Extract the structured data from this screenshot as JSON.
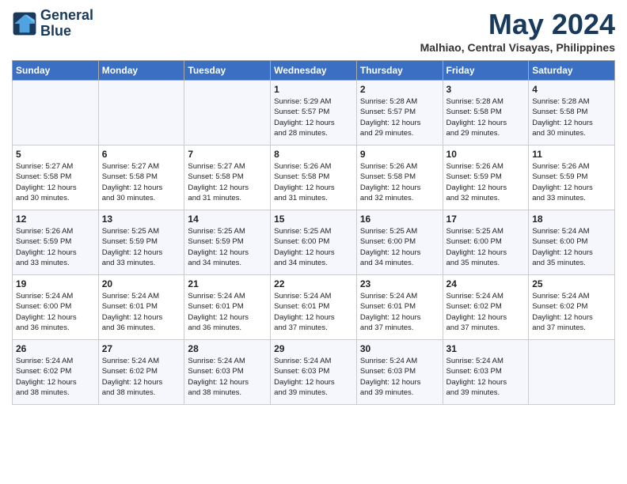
{
  "header": {
    "logo_line1": "General",
    "logo_line2": "Blue",
    "month_title": "May 2024",
    "location": "Malhiao, Central Visayas, Philippines"
  },
  "weekdays": [
    "Sunday",
    "Monday",
    "Tuesday",
    "Wednesday",
    "Thursday",
    "Friday",
    "Saturday"
  ],
  "weeks": [
    [
      {
        "day": "",
        "info": ""
      },
      {
        "day": "",
        "info": ""
      },
      {
        "day": "",
        "info": ""
      },
      {
        "day": "1",
        "info": "Sunrise: 5:29 AM\nSunset: 5:57 PM\nDaylight: 12 hours\nand 28 minutes."
      },
      {
        "day": "2",
        "info": "Sunrise: 5:28 AM\nSunset: 5:57 PM\nDaylight: 12 hours\nand 29 minutes."
      },
      {
        "day": "3",
        "info": "Sunrise: 5:28 AM\nSunset: 5:58 PM\nDaylight: 12 hours\nand 29 minutes."
      },
      {
        "day": "4",
        "info": "Sunrise: 5:28 AM\nSunset: 5:58 PM\nDaylight: 12 hours\nand 30 minutes."
      }
    ],
    [
      {
        "day": "5",
        "info": "Sunrise: 5:27 AM\nSunset: 5:58 PM\nDaylight: 12 hours\nand 30 minutes."
      },
      {
        "day": "6",
        "info": "Sunrise: 5:27 AM\nSunset: 5:58 PM\nDaylight: 12 hours\nand 30 minutes."
      },
      {
        "day": "7",
        "info": "Sunrise: 5:27 AM\nSunset: 5:58 PM\nDaylight: 12 hours\nand 31 minutes."
      },
      {
        "day": "8",
        "info": "Sunrise: 5:26 AM\nSunset: 5:58 PM\nDaylight: 12 hours\nand 31 minutes."
      },
      {
        "day": "9",
        "info": "Sunrise: 5:26 AM\nSunset: 5:58 PM\nDaylight: 12 hours\nand 32 minutes."
      },
      {
        "day": "10",
        "info": "Sunrise: 5:26 AM\nSunset: 5:59 PM\nDaylight: 12 hours\nand 32 minutes."
      },
      {
        "day": "11",
        "info": "Sunrise: 5:26 AM\nSunset: 5:59 PM\nDaylight: 12 hours\nand 33 minutes."
      }
    ],
    [
      {
        "day": "12",
        "info": "Sunrise: 5:26 AM\nSunset: 5:59 PM\nDaylight: 12 hours\nand 33 minutes."
      },
      {
        "day": "13",
        "info": "Sunrise: 5:25 AM\nSunset: 5:59 PM\nDaylight: 12 hours\nand 33 minutes."
      },
      {
        "day": "14",
        "info": "Sunrise: 5:25 AM\nSunset: 5:59 PM\nDaylight: 12 hours\nand 34 minutes."
      },
      {
        "day": "15",
        "info": "Sunrise: 5:25 AM\nSunset: 6:00 PM\nDaylight: 12 hours\nand 34 minutes."
      },
      {
        "day": "16",
        "info": "Sunrise: 5:25 AM\nSunset: 6:00 PM\nDaylight: 12 hours\nand 34 minutes."
      },
      {
        "day": "17",
        "info": "Sunrise: 5:25 AM\nSunset: 6:00 PM\nDaylight: 12 hours\nand 35 minutes."
      },
      {
        "day": "18",
        "info": "Sunrise: 5:24 AM\nSunset: 6:00 PM\nDaylight: 12 hours\nand 35 minutes."
      }
    ],
    [
      {
        "day": "19",
        "info": "Sunrise: 5:24 AM\nSunset: 6:00 PM\nDaylight: 12 hours\nand 36 minutes."
      },
      {
        "day": "20",
        "info": "Sunrise: 5:24 AM\nSunset: 6:01 PM\nDaylight: 12 hours\nand 36 minutes."
      },
      {
        "day": "21",
        "info": "Sunrise: 5:24 AM\nSunset: 6:01 PM\nDaylight: 12 hours\nand 36 minutes."
      },
      {
        "day": "22",
        "info": "Sunrise: 5:24 AM\nSunset: 6:01 PM\nDaylight: 12 hours\nand 37 minutes."
      },
      {
        "day": "23",
        "info": "Sunrise: 5:24 AM\nSunset: 6:01 PM\nDaylight: 12 hours\nand 37 minutes."
      },
      {
        "day": "24",
        "info": "Sunrise: 5:24 AM\nSunset: 6:02 PM\nDaylight: 12 hours\nand 37 minutes."
      },
      {
        "day": "25",
        "info": "Sunrise: 5:24 AM\nSunset: 6:02 PM\nDaylight: 12 hours\nand 37 minutes."
      }
    ],
    [
      {
        "day": "26",
        "info": "Sunrise: 5:24 AM\nSunset: 6:02 PM\nDaylight: 12 hours\nand 38 minutes."
      },
      {
        "day": "27",
        "info": "Sunrise: 5:24 AM\nSunset: 6:02 PM\nDaylight: 12 hours\nand 38 minutes."
      },
      {
        "day": "28",
        "info": "Sunrise: 5:24 AM\nSunset: 6:03 PM\nDaylight: 12 hours\nand 38 minutes."
      },
      {
        "day": "29",
        "info": "Sunrise: 5:24 AM\nSunset: 6:03 PM\nDaylight: 12 hours\nand 39 minutes."
      },
      {
        "day": "30",
        "info": "Sunrise: 5:24 AM\nSunset: 6:03 PM\nDaylight: 12 hours\nand 39 minutes."
      },
      {
        "day": "31",
        "info": "Sunrise: 5:24 AM\nSunset: 6:03 PM\nDaylight: 12 hours\nand 39 minutes."
      },
      {
        "day": "",
        "info": ""
      }
    ]
  ]
}
